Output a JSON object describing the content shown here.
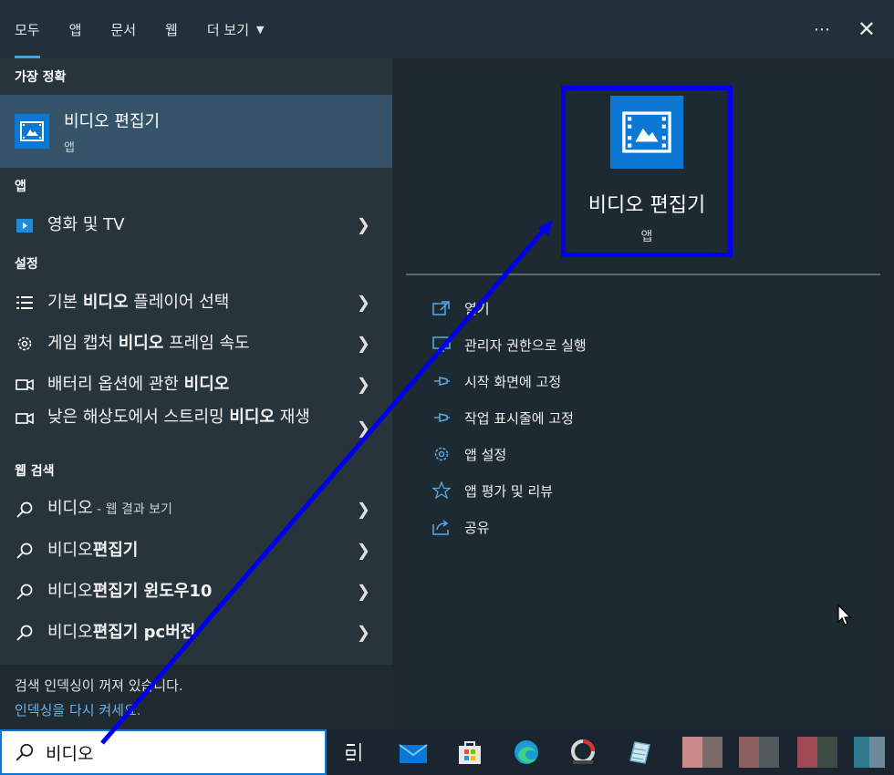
{
  "tabs": [
    {
      "label": "모두",
      "active": true
    },
    {
      "label": "앱"
    },
    {
      "label": "문서"
    },
    {
      "label": "웹"
    },
    {
      "label": "더 보기"
    }
  ],
  "top_actions": {
    "more": "⋯",
    "close": "✕"
  },
  "best_match": {
    "section": "가장 정확",
    "name": "비디오 편집기",
    "type": "앱"
  },
  "apps": {
    "section": "앱",
    "items": [
      {
        "label": "영화 및 TV",
        "icon": "movies-tv-icon"
      }
    ]
  },
  "settings": {
    "section": "설정",
    "items": [
      {
        "pre": "기본 ",
        "bold": "비디오",
        "post": " 플레이어 선택",
        "icon": "list-icon"
      },
      {
        "pre": "게임 캡처 ",
        "bold": "비디오",
        "post": " 프레임 속도",
        "icon": "gear-icon"
      },
      {
        "pre": "배터리 옵션에 관한 ",
        "bold": "비디오",
        "post": "",
        "icon": "camera-icon"
      },
      {
        "pre": "낮은 해상도에서 스트리밍 ",
        "bold": "비디오",
        "post": " 재생",
        "icon": "camera-icon"
      }
    ]
  },
  "web": {
    "section": "웹 검색",
    "items": [
      {
        "pre": "비디오",
        "bold": "",
        "post": "",
        "small": " - 웹 결과 보기"
      },
      {
        "pre": "비디오",
        "bold": "편집기",
        "post": "",
        "small": ""
      },
      {
        "pre": "비디오",
        "bold": "편집기 윈도우10",
        "post": "",
        "small": ""
      },
      {
        "pre": "비디오",
        "bold": "편집기 pc버전",
        "post": "",
        "small": ""
      }
    ]
  },
  "notice": {
    "line1": "검색 인덱싱이 꺼져 있습니다.",
    "line2": "인덱싱을 다시 켜세요."
  },
  "detail": {
    "name": "비디오 편집기",
    "type": "앱",
    "actions": [
      {
        "label": "열기",
        "icon": "open-icon"
      },
      {
        "label": "관리자 권한으로 실행",
        "icon": "admin-icon"
      },
      {
        "label": "시작 화면에 고정",
        "icon": "pin-icon"
      },
      {
        "label": "작업 표시줄에 고정",
        "icon": "pin-icon"
      },
      {
        "label": "앱 설정",
        "icon": "gear-icon"
      },
      {
        "label": "앱 평가 및 리뷰",
        "icon": "star-icon"
      },
      {
        "label": "공유",
        "icon": "share-icon"
      }
    ]
  },
  "search": {
    "value": "비디오"
  },
  "colors": {
    "accent": "#0a78d4",
    "highlight_box": "#0000ee",
    "arrow": "#0000ee"
  }
}
